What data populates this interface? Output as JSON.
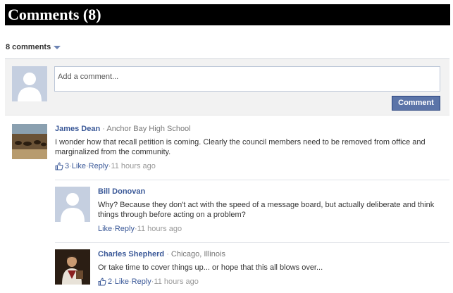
{
  "header": {
    "title": "Comments (8)"
  },
  "comment_count": {
    "label": "8 comments"
  },
  "compose": {
    "placeholder": "Add a comment...",
    "button_label": "Comment"
  },
  "comments": [
    {
      "name": "James Dean",
      "separator": " · ",
      "affiliation": "Anchor Bay High School",
      "text": "I wonder how that recall petition is coming. Clearly the council members need to be removed from office and marginalized from the community.",
      "likes": "3",
      "like_label": "Like",
      "reply_label": "Reply",
      "time": "11 hours ago",
      "dot": " · "
    },
    {
      "name": "Bill Donovan",
      "text": "Why? Because they don't act with the speed of a message board, but actually deliberate and think things through before acting on a problem?",
      "like_label": "Like",
      "reply_label": "Reply",
      "time": "11 hours ago",
      "dot": " · "
    },
    {
      "name": "Charles Shepherd",
      "separator": " · ",
      "affiliation": "Chicago, Illinois",
      "text": "Or take time to cover things up... or hope that this all blows over...",
      "likes": "2",
      "like_label": "Like",
      "reply_label": "Reply",
      "time": "11 hours ago",
      "dot": " · "
    }
  ],
  "colors": {
    "link": "#3b5998",
    "button": "#5b74a8",
    "header_bg": "#000000",
    "compose_bg": "#f2f2f2"
  },
  "icons": {
    "like": "thumbs-up-icon",
    "default_avatar": "default-avatar-icon"
  }
}
